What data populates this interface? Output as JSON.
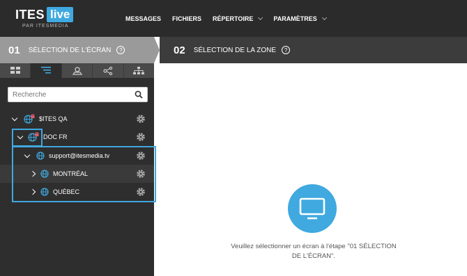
{
  "brand": {
    "logo_main": "ITES",
    "logo_badge": "live",
    "logo_sub": "PAR ITESMEDIA"
  },
  "nav": {
    "items": [
      {
        "label": "MESSAGES"
      },
      {
        "label": "FICHIERS"
      },
      {
        "label": "RÉPERTOIRE"
      },
      {
        "label": "PARAMÈTRES"
      }
    ]
  },
  "step1": {
    "number": "01",
    "title": "SÉLECTION DE L'ÉCRAN",
    "help": "?"
  },
  "step2": {
    "number": "02",
    "title": "SÉLECTION DE LA ZONE",
    "help": "?"
  },
  "tabs": [
    "grid-icon",
    "list-tree-icon",
    "user-location-icon",
    "share-nodes-icon",
    "hierarchy-icon"
  ],
  "search": {
    "placeholder": "Recherche"
  },
  "tree": [
    {
      "label": "$ITES QA"
    },
    {
      "label": "DOC FR"
    },
    {
      "label": "support@itesmedia.tv"
    },
    {
      "label": "MONTRÉAL"
    },
    {
      "label": "QUÉBEC"
    }
  ],
  "message": "Veuillez sélectionner un écran à l'étape \"01 SÉLECTION DE L'ÉCRAN\".",
  "colors": {
    "accent": "#3fa9e0",
    "topbar": "#2b2b2b",
    "sidebar": "#2e2e2e"
  }
}
